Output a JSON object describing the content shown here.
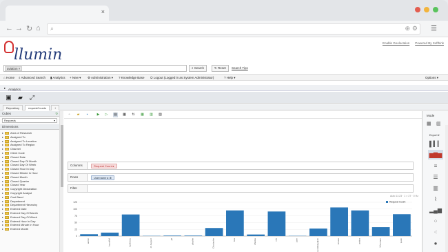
{
  "browser": {
    "tab_close": "×",
    "nav": {
      "back": "←",
      "forward": "→",
      "reload": "↻",
      "home": "⌂"
    },
    "url": {
      "search_icon": "search-icon",
      "zoom_icon": "zoom-icon",
      "settings_icon": "settings-icon"
    },
    "menu_icon": "menu-icon",
    "dots": [
      "#e35d4f",
      "#f2b43c",
      "#59c35c"
    ]
  },
  "header": {
    "logo_text": "llumin",
    "links": [
      "Enable Geolocation",
      "Powered By Softhink"
    ]
  },
  "search": {
    "tag": "aviation ×",
    "search_label": "Search",
    "reset_label": "Reset",
    "tips_label": "Search Tips"
  },
  "menu": {
    "items": [
      "Home",
      "Advanced Search",
      "Analytics",
      "New ▾",
      "Administration ▾",
      "Knowledge Base",
      "Logout (Logged in as System Administrator)",
      "Help ▾"
    ],
    "options": "Options ▾"
  },
  "breadcrumb": "Analytics",
  "tabs": [
    "Repository",
    "requestCounts",
    "+"
  ],
  "left_panel": {
    "cubes_label": "Cubes",
    "cube_select": "Requests",
    "dimensions_label": "Dimensions",
    "tree": [
      "Area of Research",
      "Assigned To",
      "Assigned To Location",
      "Assigned To Region",
      "Channel",
      "Client Code",
      "Closed Date",
      "Closed Day Of Month",
      "Closed Day Of Week",
      "Closed Hour In Day",
      "Closed Minute In Hour",
      "Closed Month",
      "Closed Quarter",
      "Closed Year",
      "Copyright Declaration",
      "Copyright Analyst",
      "Cost Band",
      "Department",
      "Department Hierarchy",
      "Entered Date",
      "Entered Day Of Month",
      "Entered Day Of Week",
      "Entered Hour In Day",
      "Entered Minute In Hour",
      "Entered Month"
    ]
  },
  "query": {
    "columns_label": "Columns",
    "columns_chip": "Request Count",
    "rows_label": "Rows",
    "rows_chip": "Username",
    "filter_label": "Filter",
    "info": "Auto 11:23 · 1 × 27 · 0 Hz"
  },
  "right_panel": {
    "mode_label": "Mode",
    "export_label": "Export ▾"
  },
  "chart_data": {
    "type": "bar",
    "legend": "Request Count",
    "legend_position": "top-right",
    "ylim": [
      0,
      125
    ],
    "yticks": [
      0,
      25,
      50,
      75,
      100,
      125
    ],
    "categories": [
      "admin",
      "bwoolfall",
      "bpeltreau",
      "ch.hupport",
      "jbf",
      "gkrylke",
      "Olivotechie",
      "bria",
      "dfeldes",
      "cka",
      "jaier",
      "jenner.bibbley@ch",
      "mhabe",
      "ambra",
      "ldheunger",
      "tpolin"
    ],
    "values": [
      7,
      13,
      80,
      1,
      2,
      2,
      30,
      95,
      6,
      91,
      1,
      28,
      106,
      95,
      33,
      81
    ],
    "color": "#2a77b8",
    "grid": true
  }
}
